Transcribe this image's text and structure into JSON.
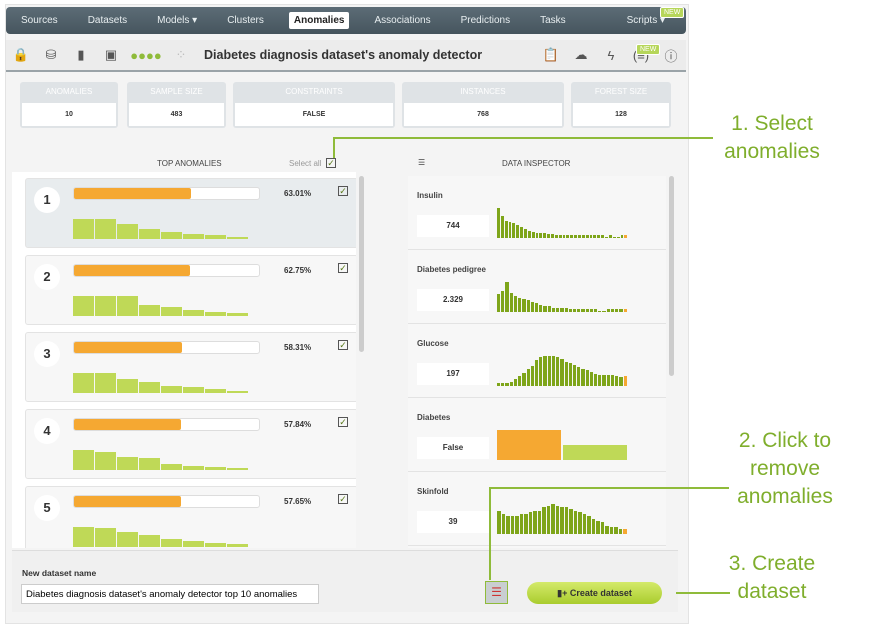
{
  "nav": {
    "items": [
      "Sources",
      "Datasets",
      "Models ▾",
      "Clusters",
      "Anomalies",
      "Associations",
      "Predictions",
      "Tasks"
    ],
    "active": "Anomalies",
    "scripts": "Scripts ▾",
    "new_badge": "NEW"
  },
  "toolbar": {
    "title": "Diabetes diagnosis dataset's anomaly detector",
    "new_badge": "NEW"
  },
  "cards": [
    {
      "label": "ANOMALIES",
      "value": "10"
    },
    {
      "label": "SAMPLE SIZE",
      "value": "483"
    },
    {
      "label": "CONSTRAINTS",
      "value": "FALSE"
    },
    {
      "label": "INSTANCES",
      "value": "768"
    },
    {
      "label": "FOREST SIZE",
      "value": "128"
    }
  ],
  "top_anomalies": {
    "title": "TOP ANOMALIES",
    "select_all": "Select all",
    "items": [
      {
        "rank": "1",
        "score": "63.01%",
        "fill": 63.01,
        "bars": [
          20,
          20,
          15,
          10,
          7,
          5,
          4,
          2
        ]
      },
      {
        "rank": "2",
        "score": "62.75%",
        "fill": 62.75,
        "bars": [
          20,
          20,
          20,
          11,
          9,
          6,
          4,
          3
        ]
      },
      {
        "rank": "3",
        "score": "58.31%",
        "fill": 58.31,
        "bars": [
          20,
          20,
          14,
          11,
          7,
          6,
          4,
          2
        ]
      },
      {
        "rank": "4",
        "score": "57.84%",
        "fill": 57.84,
        "bars": [
          20,
          18,
          13,
          12,
          6,
          4,
          3,
          2
        ]
      },
      {
        "rank": "5",
        "score": "57.65%",
        "fill": 57.65,
        "bars": [
          20,
          19,
          15,
          12,
          8,
          6,
          4,
          3
        ]
      }
    ]
  },
  "inspector": {
    "title": "DATA INSPECTOR",
    "features": [
      {
        "name": "Insulin",
        "value": "744",
        "bars": [
          28,
          21,
          16,
          15,
          14,
          12,
          10,
          8,
          7,
          6,
          5,
          5,
          5,
          4,
          4,
          3,
          3,
          3,
          3,
          3,
          3,
          3,
          3,
          3,
          3,
          3,
          3,
          3,
          1,
          3,
          1,
          1,
          3,
          3
        ]
      },
      {
        "name": "Diabetes pedigree",
        "value": "2.329",
        "bars": [
          16,
          19,
          27,
          17,
          14,
          13,
          12,
          11,
          9,
          8,
          6,
          5,
          5,
          4,
          4,
          4,
          4,
          3,
          3,
          3,
          3,
          3,
          3,
          3,
          1,
          1,
          3,
          3,
          3,
          3,
          3
        ]
      },
      {
        "name": "Glucose",
        "value": "197",
        "bars": [
          3,
          3,
          3,
          4,
          6,
          9,
          12,
          15,
          18,
          23,
          26,
          27,
          27,
          27,
          26,
          24,
          22,
          21,
          19,
          17,
          15,
          14,
          13,
          11,
          10,
          10,
          10,
          10,
          9,
          8,
          9
        ]
      },
      {
        "name": "Diabetes",
        "value": "False",
        "bars": [
          30,
          15
        ]
      },
      {
        "name": "Skinfold",
        "value": "39",
        "bars": [
          14,
          12,
          11,
          11,
          11,
          12,
          12,
          13,
          14,
          14,
          16,
          17,
          18,
          17,
          16,
          16,
          15,
          14,
          13,
          12,
          11,
          9,
          8,
          7,
          5,
          4,
          4,
          3,
          3
        ]
      }
    ]
  },
  "bottom": {
    "label": "New dataset name",
    "input_value": "Diabetes diagnosis dataset's anomaly detector top 10 anomalies",
    "create": "Create dataset"
  },
  "annotations": [
    "1. Select anomalies",
    "2. Click to remove anomalies",
    "3. Create dataset"
  ],
  "colors": {
    "accent": "#7fae2c",
    "score": "#f5a832",
    "bar": "#bfd957",
    "hist": "#7ea51a"
  }
}
